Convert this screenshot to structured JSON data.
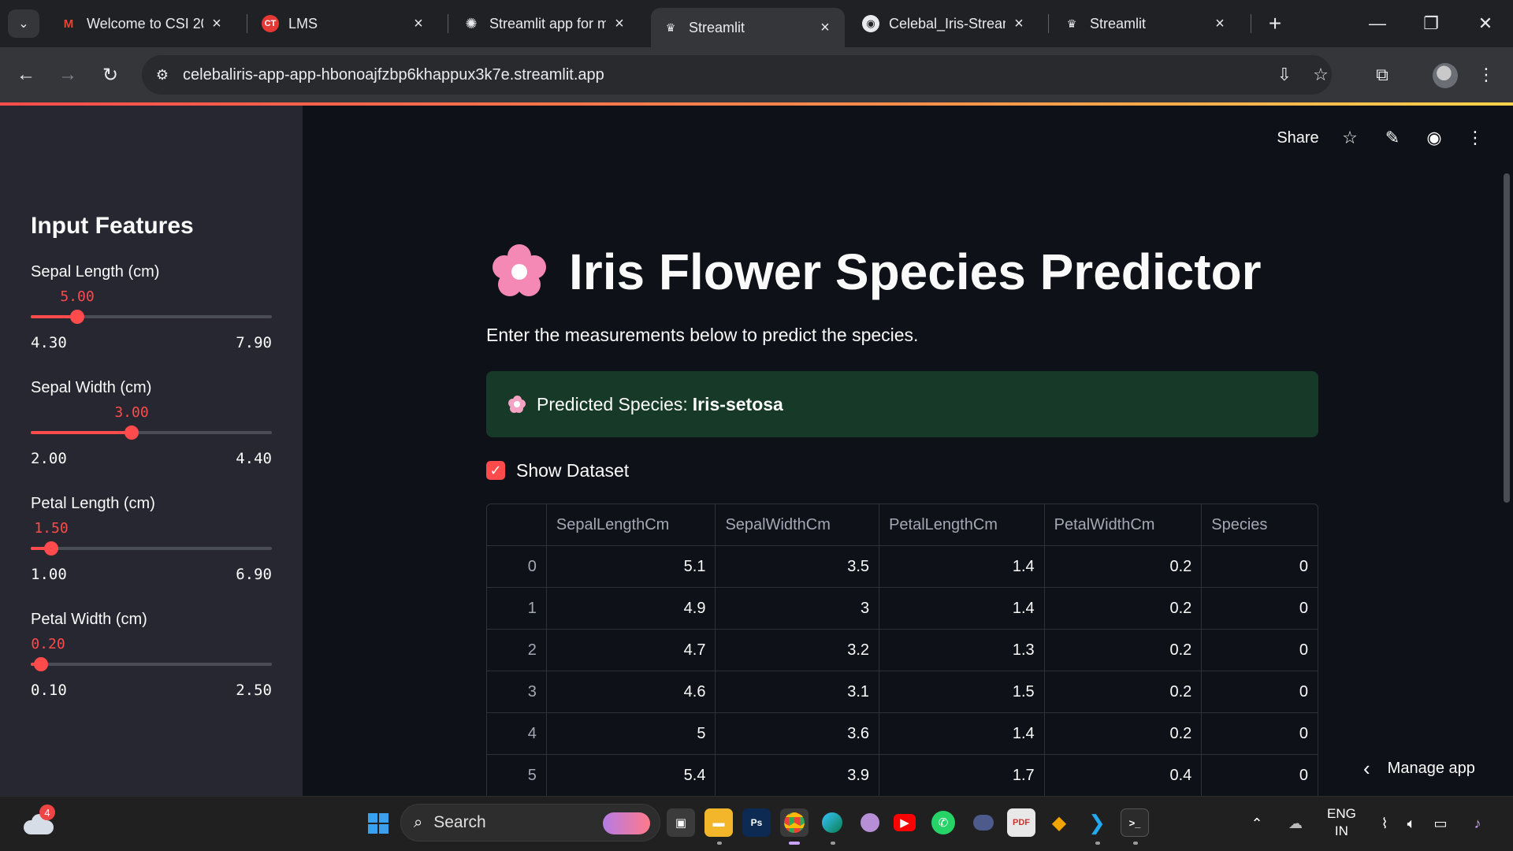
{
  "browser": {
    "tabs": [
      {
        "title": "Welcome to CSI 20",
        "icon": "gmail-icon"
      },
      {
        "title": "LMS",
        "icon": "lms-icon"
      },
      {
        "title": "Streamlit app for m",
        "icon": "openai-icon"
      },
      {
        "title": "Streamlit",
        "icon": "streamlit-icon"
      },
      {
        "title": "Celebal_Iris-Stream",
        "icon": "github-icon"
      },
      {
        "title": "Streamlit",
        "icon": "streamlit-icon"
      }
    ],
    "active_tab_index": 3,
    "url": "celebaliris-app-app-hbonoajfzbp6khappux3k7e.streamlit.app"
  },
  "app_header": {
    "share_label": "Share"
  },
  "sidebar": {
    "title": "Input Features",
    "sliders": [
      {
        "label": "Sepal Length (cm)",
        "value": "5.00",
        "min": "4.30",
        "max": "7.90",
        "fraction": 0.194
      },
      {
        "label": "Sepal Width (cm)",
        "value": "3.00",
        "min": "2.00",
        "max": "4.40",
        "fraction": 0.417
      },
      {
        "label": "Petal Length (cm)",
        "value": "1.50",
        "min": "1.00",
        "max": "6.90",
        "fraction": 0.085
      },
      {
        "label": "Petal Width (cm)",
        "value": "0.20",
        "min": "0.10",
        "max": "2.50",
        "fraction": 0.042
      }
    ]
  },
  "main": {
    "title": "Iris Flower Species Predictor",
    "subtitle": "Enter the measurements below to predict the species.",
    "prediction_label": "Predicted Species:",
    "prediction_value": "Iris-setosa",
    "show_dataset_label": "Show Dataset",
    "show_dataset_checked": true,
    "table": {
      "columns": [
        "",
        "SepalLengthCm",
        "SepalWidthCm",
        "PetalLengthCm",
        "PetalWidthCm",
        "Species"
      ],
      "rows": [
        [
          "0",
          "5.1",
          "3.5",
          "1.4",
          "0.2",
          "0"
        ],
        [
          "1",
          "4.9",
          "3",
          "1.4",
          "0.2",
          "0"
        ],
        [
          "2",
          "4.7",
          "3.2",
          "1.3",
          "0.2",
          "0"
        ],
        [
          "3",
          "4.6",
          "3.1",
          "1.5",
          "0.2",
          "0"
        ],
        [
          "4",
          "5",
          "3.6",
          "1.4",
          "0.2",
          "0"
        ],
        [
          "5",
          "5.4",
          "3.9",
          "1.7",
          "0.4",
          "0"
        ]
      ]
    },
    "manage_app_label": "Manage app"
  },
  "taskbar": {
    "weather_badge": "4",
    "search_label": "Search",
    "lang_line1": "ENG",
    "lang_line2": "IN"
  },
  "colors": {
    "accent": "#ff4b4b",
    "success_bg": "#173928",
    "app_bg": "#0e1117",
    "sidebar_bg": "#262730"
  }
}
